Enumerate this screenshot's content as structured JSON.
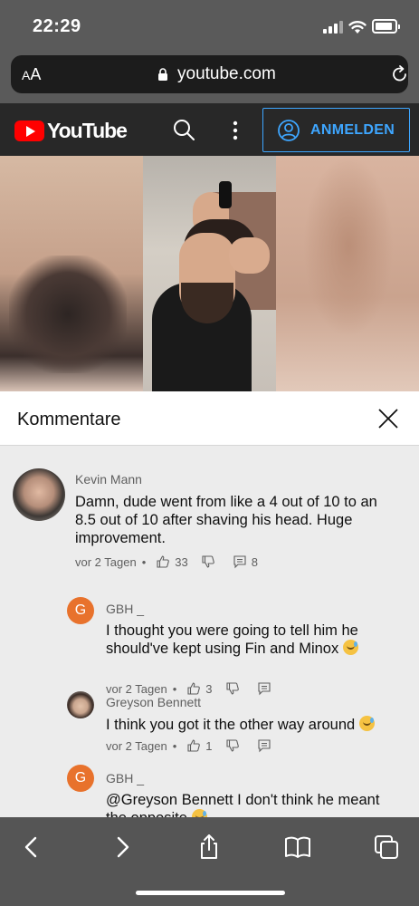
{
  "status_bar": {
    "time": "22:29"
  },
  "browser": {
    "text_size_label_small": "A",
    "text_size_label_large": "A",
    "url": "youtube.com"
  },
  "youtube_header": {
    "logo_text": "YouTube",
    "signin_label": "ANMELDEN"
  },
  "comments": {
    "title": "Kommentare",
    "items": [
      {
        "author": "Kevin Mann",
        "text": "Damn, dude went from like a 4 out of 10 to an 8.5 out of 10 after shaving his head.  Huge improvement.",
        "time": "vor 2 Tagen",
        "likes": "33",
        "replies": "8"
      },
      {
        "author": "GBH _",
        "avatar_letter": "G",
        "text": "I thought you were going to tell him he should've kept using Fin and Minox",
        "time": "vor 2 Tagen",
        "likes": "3"
      },
      {
        "author": "Greyson Bennett",
        "text": "I think you got it the other way around",
        "time": "vor 2 Tagen",
        "likes": "1"
      },
      {
        "author": "GBH _",
        "avatar_letter": "G",
        "text": " @Greyson Bennett  I don't think he meant the opposite"
      }
    ]
  },
  "colors": {
    "accent_blue": "#3ea6ff",
    "youtube_red": "#ff0000",
    "avatar_orange": "#e8722c"
  }
}
